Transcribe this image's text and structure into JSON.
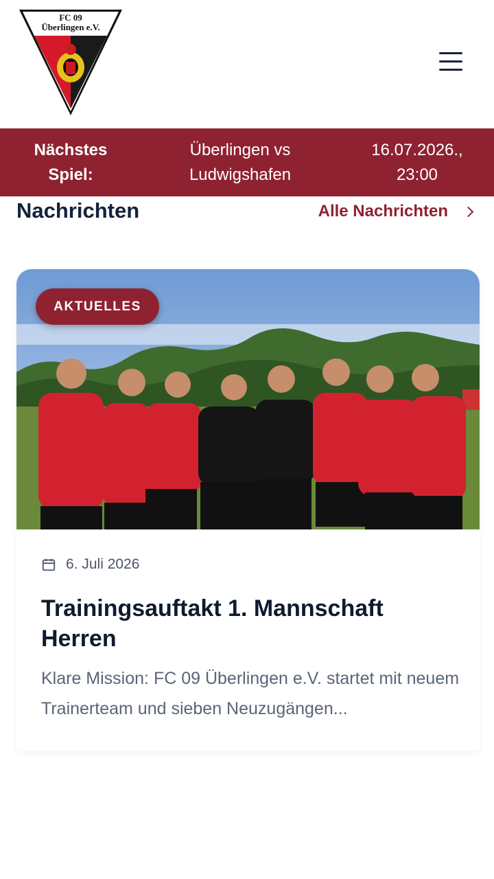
{
  "header": {
    "logo_text_line1": "FC 09",
    "logo_text_line2": "Überlingen e.V.",
    "menu_icon": "hamburger-menu-icon"
  },
  "next_match": {
    "label_line1": "Nächstes",
    "label_line2": "Spiel:",
    "teams_line1": "Überlingen vs",
    "teams_line2": "Ludwigshafen",
    "date_line1": "16.07.2026.,",
    "time_line2": "23:00"
  },
  "news_section": {
    "title": "Nachrichten",
    "all_link": "Alle Nachrichten"
  },
  "news_card": {
    "badge": "AKTUELLES",
    "date": "6. Juli 2026",
    "title": "Trainingsauftakt 1. Mannschaft Herren",
    "excerpt": "Klare Mission: FC 09 Überlingen e.V. startet mit neuem Trainerteam und sieben Neuzugängen..."
  },
  "colors": {
    "brand_red": "#8f2231",
    "text_dark": "#14223a",
    "text_muted": "#5a6578"
  }
}
